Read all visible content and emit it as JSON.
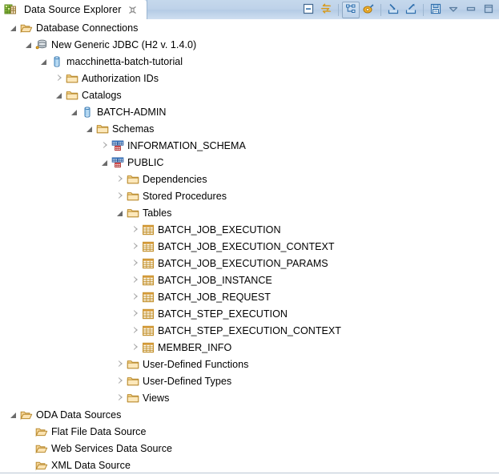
{
  "tab": {
    "title": "Data Source Explorer",
    "icon": "data-source-explorer-icon",
    "close_icon": "close-icon"
  },
  "toolbar": {
    "buttons": [
      {
        "name": "collapse-all-button",
        "icon": "collapse-all-icon",
        "pressed": false
      },
      {
        "name": "refresh-button",
        "icon": "refresh-arrows-icon",
        "pressed": false
      },
      {
        "name": "link-with-editor-button",
        "icon": "link-tree-icon",
        "pressed": true
      },
      {
        "name": "new-connection-profile-button",
        "icon": "connection-profile-icon",
        "pressed": false
      },
      {
        "name": "import-button",
        "icon": "import-arrow-icon",
        "pressed": false
      },
      {
        "name": "export-button",
        "icon": "export-arrow-icon",
        "pressed": false
      },
      {
        "name": "save-button",
        "icon": "save-disk-icon",
        "pressed": false
      },
      {
        "name": "view-menu-button",
        "icon": "chevron-down-icon",
        "pressed": false
      },
      {
        "name": "minimize-view-button",
        "icon": "minimize-icon",
        "pressed": false
      },
      {
        "name": "maximize-view-button",
        "icon": "maximize-icon",
        "pressed": false
      }
    ]
  },
  "colors": {
    "tab_active_bg": "#ffffff",
    "tabbar_gradient_top": "#c5d8ec",
    "tabbar_gradient_bottom": "#cfdff0",
    "folder_yellow": "#f5c86a",
    "folder_open_yellow": "#e8b960",
    "table_icon_orange": "#d79b3a",
    "catalog_blue": "#6fa8dc",
    "text": "#000000",
    "arrow_gray": "#a6a6a6"
  },
  "tree": {
    "nodes": [
      {
        "label": "Database Connections",
        "depth": 0,
        "state": "expanded",
        "icon": "open-folder-icon"
      },
      {
        "label": "New Generic JDBC (H2 v. 1.4.0)",
        "depth": 1,
        "state": "expanded",
        "icon": "database-connection-icon"
      },
      {
        "label": "macchinetta-batch-tutorial",
        "depth": 2,
        "state": "expanded",
        "icon": "database-cylinder-icon"
      },
      {
        "label": "Authorization IDs",
        "depth": 3,
        "state": "collapsed",
        "icon": "folder-icon"
      },
      {
        "label": "Catalogs",
        "depth": 3,
        "state": "expanded",
        "icon": "folder-icon"
      },
      {
        "label": "BATCH-ADMIN",
        "depth": 4,
        "state": "expanded",
        "icon": "database-cylinder-icon"
      },
      {
        "label": "Schemas",
        "depth": 5,
        "state": "expanded",
        "icon": "folder-icon"
      },
      {
        "label": "INFORMATION_SCHEMA",
        "depth": 6,
        "state": "collapsed",
        "icon": "schema-icon"
      },
      {
        "label": "PUBLIC",
        "depth": 6,
        "state": "expanded",
        "icon": "schema-icon"
      },
      {
        "label": "Dependencies",
        "depth": 7,
        "state": "collapsed",
        "icon": "folder-icon"
      },
      {
        "label": "Stored Procedures",
        "depth": 7,
        "state": "collapsed",
        "icon": "folder-icon"
      },
      {
        "label": "Tables",
        "depth": 7,
        "state": "expanded",
        "icon": "folder-icon"
      },
      {
        "label": "BATCH_JOB_EXECUTION",
        "depth": 8,
        "state": "collapsed",
        "icon": "table-icon"
      },
      {
        "label": "BATCH_JOB_EXECUTION_CONTEXT",
        "depth": 8,
        "state": "collapsed",
        "icon": "table-icon"
      },
      {
        "label": "BATCH_JOB_EXECUTION_PARAMS",
        "depth": 8,
        "state": "collapsed",
        "icon": "table-icon"
      },
      {
        "label": "BATCH_JOB_INSTANCE",
        "depth": 8,
        "state": "collapsed",
        "icon": "table-icon"
      },
      {
        "label": "BATCH_JOB_REQUEST",
        "depth": 8,
        "state": "collapsed",
        "icon": "table-icon"
      },
      {
        "label": "BATCH_STEP_EXECUTION",
        "depth": 8,
        "state": "collapsed",
        "icon": "table-icon"
      },
      {
        "label": "BATCH_STEP_EXECUTION_CONTEXT",
        "depth": 8,
        "state": "collapsed",
        "icon": "table-icon"
      },
      {
        "label": "MEMBER_INFO",
        "depth": 8,
        "state": "collapsed",
        "icon": "table-icon"
      },
      {
        "label": "User-Defined Functions",
        "depth": 7,
        "state": "collapsed",
        "icon": "folder-icon"
      },
      {
        "label": "User-Defined Types",
        "depth": 7,
        "state": "collapsed",
        "icon": "folder-icon"
      },
      {
        "label": "Views",
        "depth": 7,
        "state": "collapsed",
        "icon": "folder-icon"
      },
      {
        "label": "ODA Data Sources",
        "depth": 0,
        "state": "expanded",
        "icon": "open-folder-icon"
      },
      {
        "label": "Flat File Data Source",
        "depth": 1,
        "state": "leaf",
        "icon": "open-folder-icon"
      },
      {
        "label": "Web Services Data Source",
        "depth": 1,
        "state": "leaf",
        "icon": "open-folder-icon"
      },
      {
        "label": "XML Data Source",
        "depth": 1,
        "state": "leaf",
        "icon": "open-folder-icon"
      }
    ]
  }
}
